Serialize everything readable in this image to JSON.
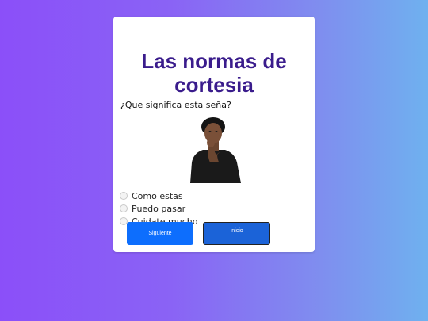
{
  "quiz": {
    "title_line1": "Las normas de",
    "title_line2": "cortesia",
    "question": "¿Que significa esta seña?",
    "image_alt": "Mujer realizando la seña",
    "options": [
      {
        "label": "Como estas",
        "selected": false
      },
      {
        "label": "Puedo pasar",
        "selected": false
      },
      {
        "label": "Cuidate mucho",
        "selected": false
      }
    ],
    "buttons": {
      "next_label": "Siguiente",
      "home_label": "Inicio"
    }
  },
  "colors": {
    "title": "#3a1c8c",
    "button_primary": "#0d6efd",
    "button_secondary": "#1b63d8",
    "background_start": "#8b4ff9",
    "background_end": "#6fb1ef"
  }
}
